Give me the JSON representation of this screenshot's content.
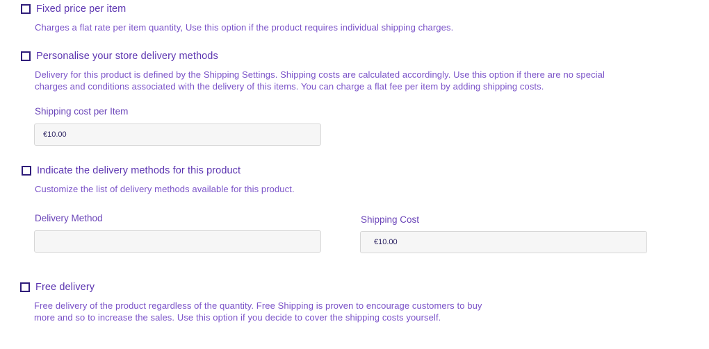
{
  "options": {
    "fixed_price": {
      "title": "Fixed price per item",
      "description": "Charges a flat rate per item quantity, Use this option if the product requires individual shipping charges.",
      "checked": false
    },
    "personalise": {
      "title": "Personalise your store delivery methods",
      "description_line1": "Delivery for this product is defined by the Shipping Settings. Shipping costs are calculated accordingly. Use this option if there are no special",
      "description_line2": "charges and conditions associated with the delivery of this items. You can charge a flat fee per item by adding shipping costs.",
      "checked": false,
      "shipping_cost_label": "Shipping cost per Item",
      "shipping_cost_value": "€10.00"
    },
    "indicate_methods": {
      "title": "Indicate the delivery methods for this product",
      "description": "Customize the list of delivery methods available for this product.",
      "checked": false,
      "delivery_method_label": "Delivery Method",
      "delivery_method_value": "",
      "shipping_cost_label": "Shipping Cost",
      "shipping_cost_value": "€10.00"
    },
    "free_delivery": {
      "title": "Free delivery",
      "description_line1": "Free delivery of the product regardless of the quantity. Free Shipping is proven to encourage customers to buy",
      "description_line2": "more and so to increase the sales. Use this option if you decide to cover the shipping costs yourself.",
      "checked": false
    }
  },
  "colors": {
    "text_accent": "#6b45b8",
    "checkbox_border": "#2f1d7a",
    "input_background": "#f6f6f6"
  }
}
